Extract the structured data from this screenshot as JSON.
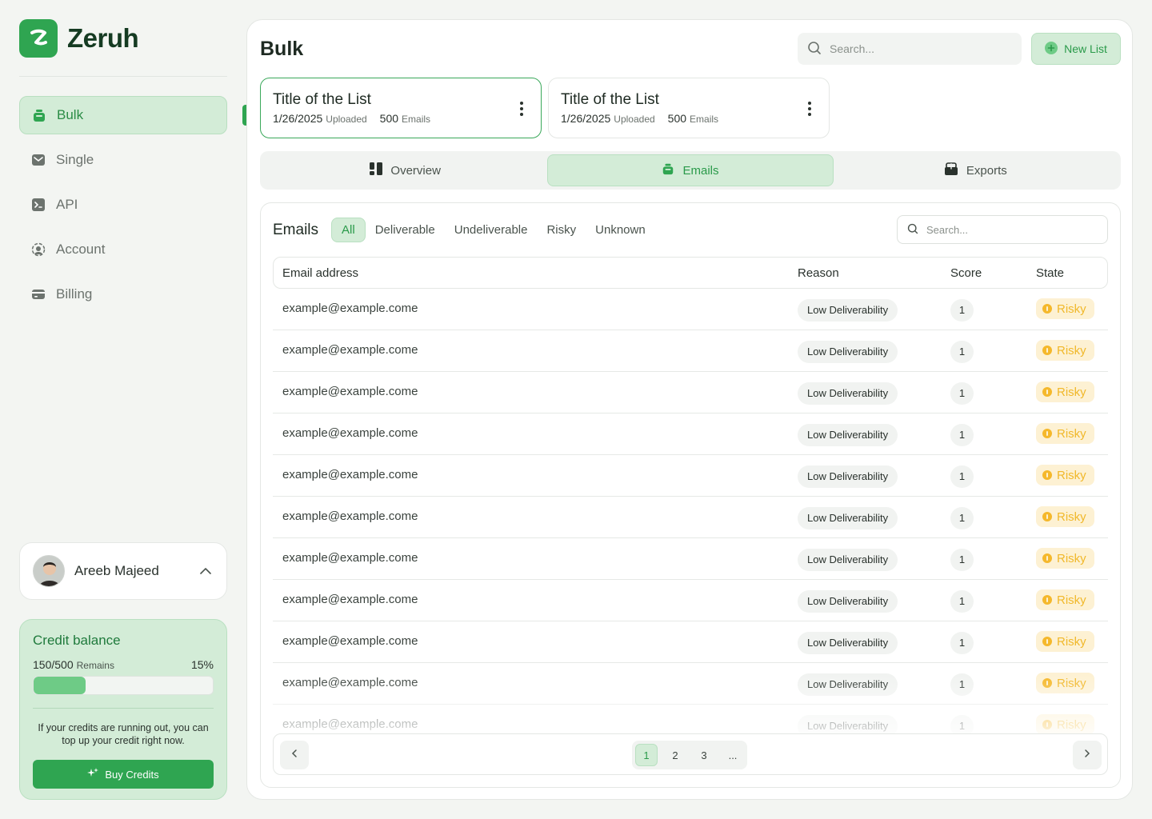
{
  "brand": {
    "name": "Zeruh",
    "accent": "#2fa551"
  },
  "sidebar": {
    "items": [
      {
        "label": "Bulk",
        "icon": "bag-icon",
        "active": true
      },
      {
        "label": "Single",
        "icon": "mail-icon",
        "active": false
      },
      {
        "label": "API",
        "icon": "terminal-icon",
        "active": false
      },
      {
        "label": "Account",
        "icon": "account-icon",
        "active": false
      },
      {
        "label": "Billing",
        "icon": "card-icon",
        "active": false
      }
    ]
  },
  "user": {
    "name": "Areeb Majeed"
  },
  "credit": {
    "title": "Credit balance",
    "used": "150",
    "total": "/500",
    "remains_label": "Remains",
    "percent_label": "15%",
    "progress": 0.29,
    "note": "If your credits are running out, you can top up your credit right now.",
    "buy_label": "Buy Credits"
  },
  "header": {
    "title": "Bulk",
    "search_placeholder": "Search...",
    "new_list_label": "New List"
  },
  "lists": [
    {
      "title": "Title of the List",
      "date": "1/26/2025",
      "uploaded_label": "Uploaded",
      "count": "500",
      "count_label": "Emails",
      "active": true
    },
    {
      "title": "Title of the List",
      "date": "1/26/2025",
      "uploaded_label": "Uploaded",
      "count": "500",
      "count_label": "Emails",
      "active": false
    }
  ],
  "tabs": [
    {
      "label": "Overview",
      "icon": "overview-icon",
      "active": false
    },
    {
      "label": "Emails",
      "icon": "bag-icon",
      "active": true
    },
    {
      "label": "Exports",
      "icon": "export-icon",
      "active": false
    }
  ],
  "emails": {
    "label": "Emails",
    "filters": [
      "All",
      "Deliverable",
      "Undeliverable",
      "Risky",
      "Unknown"
    ],
    "active_filter": "All",
    "search_placeholder": "Search...",
    "columns": [
      "Email address",
      "Reason",
      "Score",
      "State"
    ],
    "rows": [
      {
        "email": "example@example.come",
        "reason": "Low Deliverability",
        "score": "1",
        "state": "Risky"
      },
      {
        "email": "example@example.come",
        "reason": "Low Deliverability",
        "score": "1",
        "state": "Risky"
      },
      {
        "email": "example@example.come",
        "reason": "Low Deliverability",
        "score": "1",
        "state": "Risky"
      },
      {
        "email": "example@example.come",
        "reason": "Low Deliverability",
        "score": "1",
        "state": "Risky"
      },
      {
        "email": "example@example.come",
        "reason": "Low Deliverability",
        "score": "1",
        "state": "Risky"
      },
      {
        "email": "example@example.come",
        "reason": "Low Deliverability",
        "score": "1",
        "state": "Risky"
      },
      {
        "email": "example@example.come",
        "reason": "Low Deliverability",
        "score": "1",
        "state": "Risky"
      },
      {
        "email": "example@example.come",
        "reason": "Low Deliverability",
        "score": "1",
        "state": "Risky"
      },
      {
        "email": "example@example.come",
        "reason": "Low Deliverability",
        "score": "1",
        "state": "Risky"
      },
      {
        "email": "example@example.come",
        "reason": "Low Deliverability",
        "score": "1",
        "state": "Risky"
      },
      {
        "email": "example@example.come",
        "reason": "Low Deliverability",
        "score": "1",
        "state": "Risky"
      }
    ]
  },
  "pagination": {
    "pages": [
      "1",
      "2",
      "3",
      "..."
    ],
    "current": "1"
  }
}
